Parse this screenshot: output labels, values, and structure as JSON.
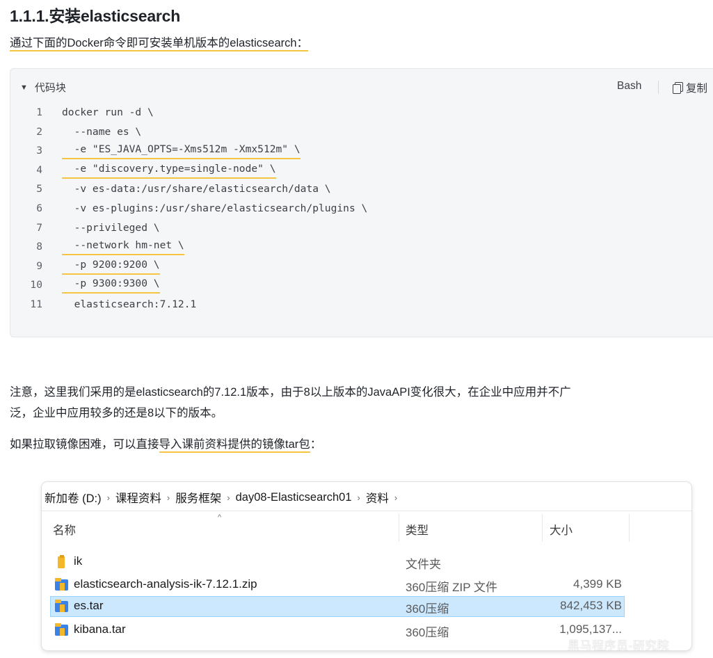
{
  "heading": "1.1.1.安装elasticsearch",
  "intro": {
    "text": "通过下面的Docker命令即可安装单机版本的elasticsearch："
  },
  "code_block": {
    "title": "代码块",
    "language": "Bash",
    "copy_label": "复制",
    "lines": [
      {
        "n": "1",
        "code": "docker run -d \\"
      },
      {
        "n": "2",
        "code": "  --name es \\"
      },
      {
        "n": "3",
        "code": "  -e \"ES_JAVA_OPTS=-Xms512m -Xmx512m\" \\"
      },
      {
        "n": "4",
        "code": "  -e \"discovery.type=single-node\" \\"
      },
      {
        "n": "5",
        "code": "  -v es-data:/usr/share/elasticsearch/data \\"
      },
      {
        "n": "6",
        "code": "  -v es-plugins:/usr/share/elasticsearch/plugins \\"
      },
      {
        "n": "7",
        "code": "  --privileged \\"
      },
      {
        "n": "8",
        "code": "  --network hm-net \\"
      },
      {
        "n": "9",
        "code": "  -p 9200:9200 \\"
      },
      {
        "n": "10",
        "code": "  -p 9300:9300 \\"
      },
      {
        "n": "11",
        "code": "  elasticsearch:7.12.1"
      }
    ]
  },
  "note": {
    "line1": "注意，这里我们采用的是elasticsearch的7.12.1版本，由于8以上版本的JavaAPI变化很大，在企业中应用并不广",
    "line2": "泛，企业中应用较多的还是8以下的版本。"
  },
  "import_hint": {
    "prefix": "如果拉取镜像困难，可以直接",
    "highlighted": "导入课前资料提供的镜像tar包",
    "suffix": "："
  },
  "explorer": {
    "breadcrumbs": [
      "新加卷 (D:)",
      "课程资料",
      "服务框架",
      "day08-Elasticsearch01",
      "资料"
    ],
    "columns": {
      "name": "名称",
      "type": "类型",
      "size": "大小"
    },
    "files": [
      {
        "name": "ik",
        "type": "文件夹",
        "size": "",
        "icon": "folder-icon"
      },
      {
        "name": "elasticsearch-analysis-ik-7.12.1.zip",
        "type": "360压缩 ZIP 文件",
        "size": "4,399 KB",
        "icon": "archive-icon"
      },
      {
        "name": "es.tar",
        "type": "360压缩",
        "size": "842,453 KB",
        "icon": "archive-icon",
        "selected": true
      },
      {
        "name": "kibana.tar",
        "type": "360压缩",
        "size": "1,095,137...",
        "icon": "archive-icon"
      }
    ]
  },
  "watermark": "黑马程序员-研究院",
  "colors": {
    "highlight_underline": "#f5c542",
    "code_bg": "#f5f6f7",
    "selection_bg": "#cce8ff",
    "selection_border": "#99d1ff"
  }
}
